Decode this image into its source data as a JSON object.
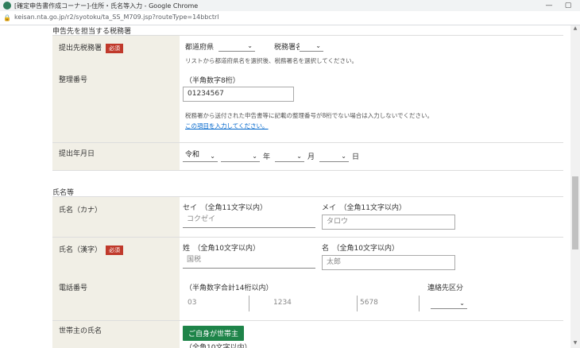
{
  "window": {
    "title": "[確定申告書作成コーナー]-住所・氏名等入力 - Google Chrome",
    "url": "keisan.nta.go.jp/r2/syotoku/ta_SS_M709.jsp?routeType=14bbctrl",
    "controls": [
      "—",
      "▢"
    ]
  },
  "section_tax_office": {
    "heading": "申告先を担当する税務署",
    "tax_office_label": "提出先税務署",
    "required_badge": "必須",
    "prefecture_label": "都道府県",
    "office_label": "税務署名",
    "office_hint": "リストから都道府県名を選択後、税務署名を選択してください。",
    "ref_label": "整理番号",
    "ref_hint": "（半角数字8桁）",
    "ref_value": "01234567",
    "ref_note": "税務署から送付された申告書等に記載の整理番号が8桁でない場合は入力しないでください。",
    "ref_link": "この項目を入力してください。",
    "date_label": "提出年月日",
    "era_value": "令和",
    "year_unit": "年",
    "month_unit": "月",
    "day_unit": "日"
  },
  "section_name": {
    "heading": "氏名等",
    "kana_label": "氏名（カナ）",
    "sei_kana_label": "セイ　（全角11文字以内）",
    "mei_kana_label": "メイ　（全角11文字以内）",
    "sei_kana_placeholder": "コクゼイ",
    "mei_kana_placeholder": "タロウ",
    "kanji_label": "氏名（漢字）",
    "required_badge": "必須",
    "sei_label": "姓　（全角10文字以内）",
    "mei_label": "名　（全角10文字以内）",
    "sei_placeholder": "国税",
    "mei_placeholder": "太郎",
    "phone_label": "電話番号",
    "phone_hint": "（半角数字合計14桁以内）",
    "phone1_placeholder": "03",
    "phone2_placeholder": "1234",
    "phone3_placeholder": "5678",
    "contact_label": "連絡先区分",
    "head_label": "世帯主の氏名",
    "self_button": "ご自身が世帯主",
    "head_hint": "（全角10文字以内）"
  }
}
